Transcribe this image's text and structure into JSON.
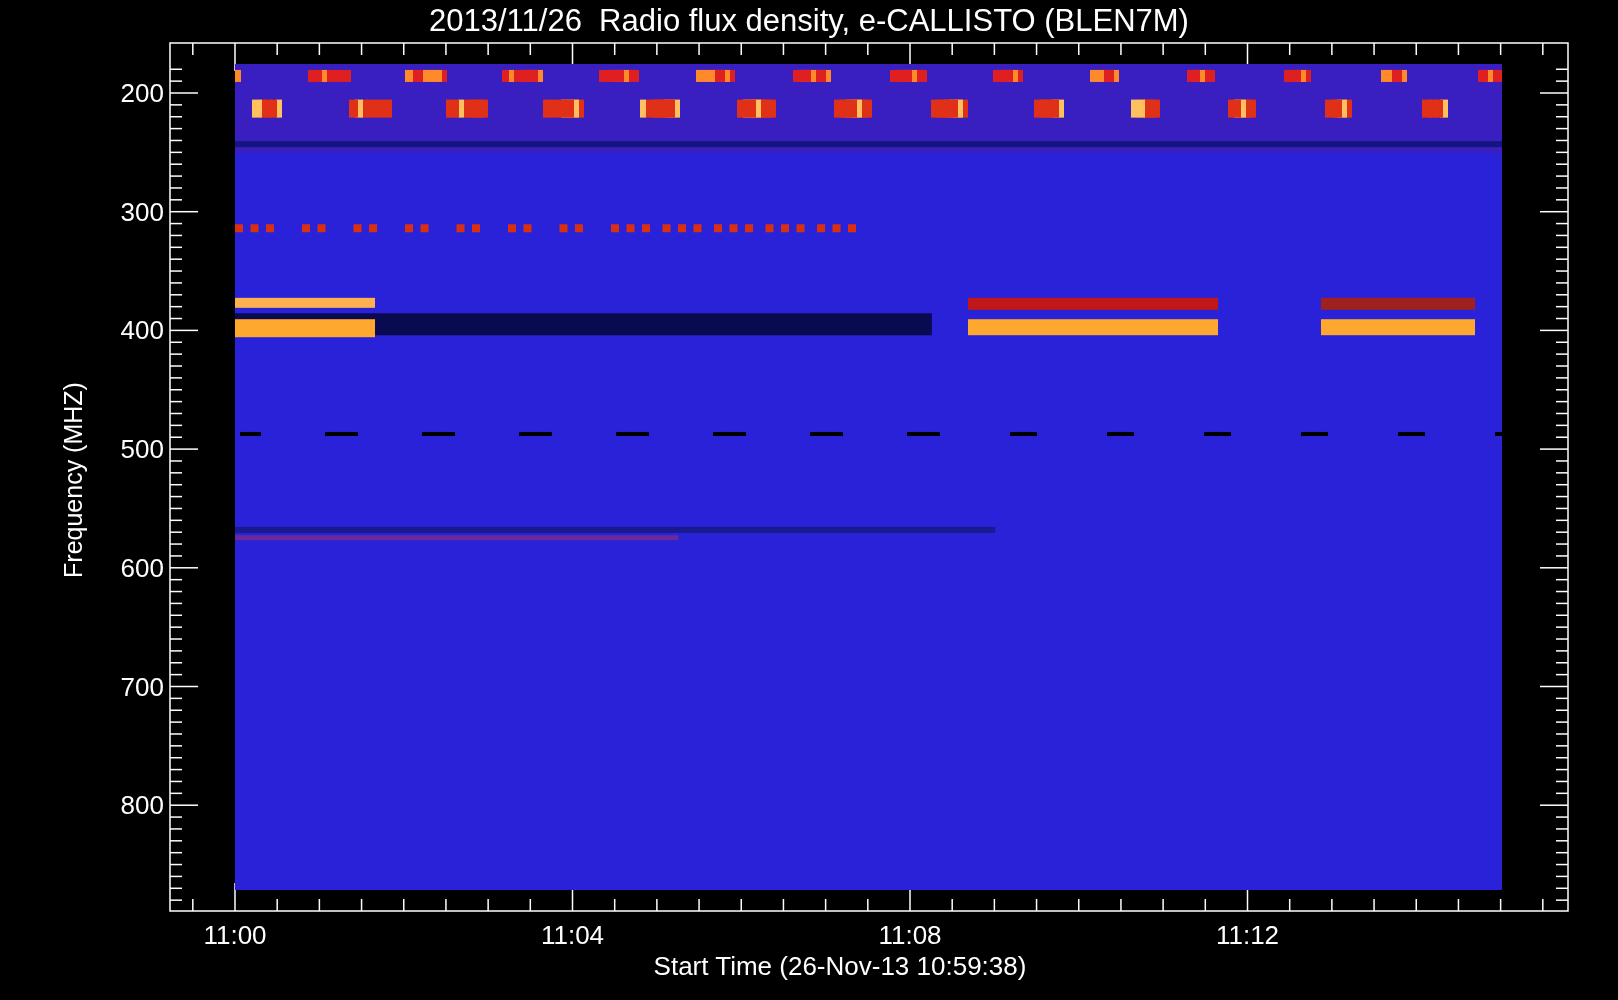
{
  "title": "2013/11/26  Radio flux density, e-CALLISTO (BLEN7M)",
  "y_axis": {
    "label": "Frequency (MHZ)",
    "ticks": [
      "200",
      "300",
      "400",
      "500",
      "600",
      "700",
      "800"
    ]
  },
  "x_axis": {
    "label": "Start Time (26-Nov-13 10:59:38)",
    "ticks": [
      "11:00",
      "11:04",
      "11:08",
      "11:12"
    ]
  }
}
